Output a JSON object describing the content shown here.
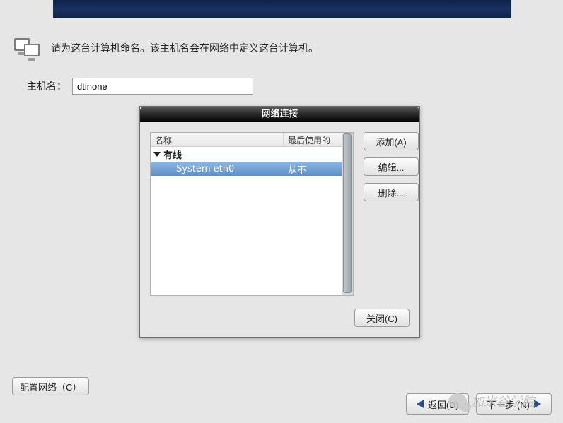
{
  "instruction_text": "请为这台计算机命名。该主机名会在网络中定义这台计算机。",
  "hostname": {
    "label": "主机名：",
    "value": "dtinone"
  },
  "dialog": {
    "title": "网络连接",
    "columns": {
      "name": "名称",
      "last_used": "最后使用的"
    },
    "group": {
      "label": "有线"
    },
    "items": [
      {
        "name": "System eth0",
        "last_used": "从不"
      }
    ],
    "buttons": {
      "add": "添加(A)",
      "edit": "编辑...",
      "delete": "删除...",
      "close": "关闭(C)"
    }
  },
  "config_network_label": "配置网络（C）",
  "nav": {
    "back": "返回(B)",
    "next": "下一步 (N)"
  },
  "watermark": "加米谷学院"
}
